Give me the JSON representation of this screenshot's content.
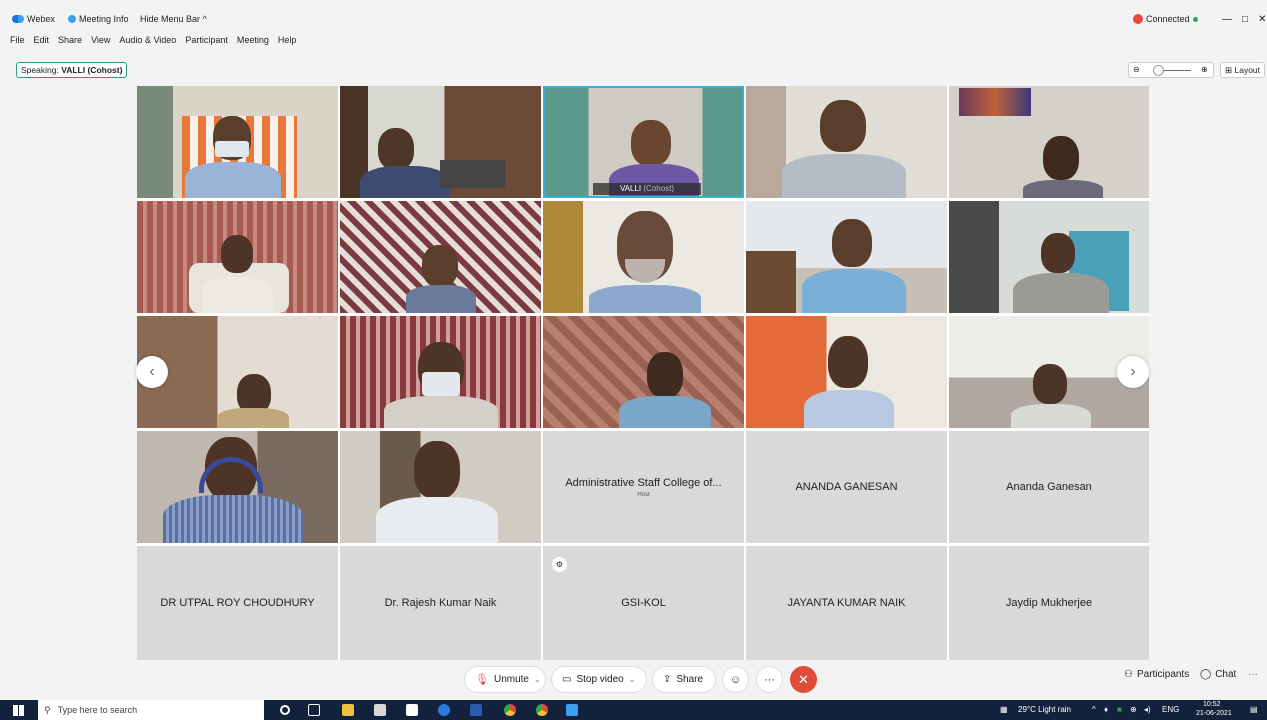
{
  "titlebar": {
    "app_name": "Webex",
    "meeting_info": "Meeting Info",
    "hide_menu": "Hide Menu Bar ^",
    "status": "Connected",
    "window_controls": [
      "—",
      "□",
      "✕"
    ]
  },
  "menu": [
    "File",
    "Edit",
    "Share",
    "View",
    "Audio & Video",
    "Participant",
    "Meeting",
    "Help"
  ],
  "speaking": {
    "prefix": "Speaking:",
    "name": "VALLI (Cohost)"
  },
  "layout_button": "Layout",
  "zoom": {
    "minus": "⊖",
    "plus": "⊕"
  },
  "tiles": {
    "valli_name": "VALLI",
    "valli_role": "(Cohost)",
    "name_tiles": [
      {
        "name": "Administrative Staff College of...",
        "sub": "Host"
      },
      {
        "name": "ANANDA GANESAN",
        "sub": ""
      },
      {
        "name": "Ananda Ganesan",
        "sub": ""
      },
      {
        "name": "DR UTPAL ROY CHOUDHURY",
        "sub": ""
      },
      {
        "name": "Dr. Rajesh Kumar Naik",
        "sub": ""
      },
      {
        "name": "GSI-KOL",
        "sub": ""
      },
      {
        "name": "JAYANTA KUMAR NAIK",
        "sub": ""
      },
      {
        "name": "Jaydip Mukherjee",
        "sub": ""
      }
    ]
  },
  "controls": {
    "unmute": "Unmute",
    "stop_video": "Stop video",
    "share": "Share",
    "participants": "Participants",
    "chat": "Chat",
    "more": "···"
  },
  "taskbar": {
    "search_placeholder": "Type here to search",
    "weather": "29°C  Light rain",
    "lang": "ENG",
    "time": "10:52",
    "date": "21-06-2021"
  },
  "colors": {
    "accent_green": "#2a9d6a",
    "leave_red": "#e04b3a",
    "taskbar": "#13223c"
  }
}
